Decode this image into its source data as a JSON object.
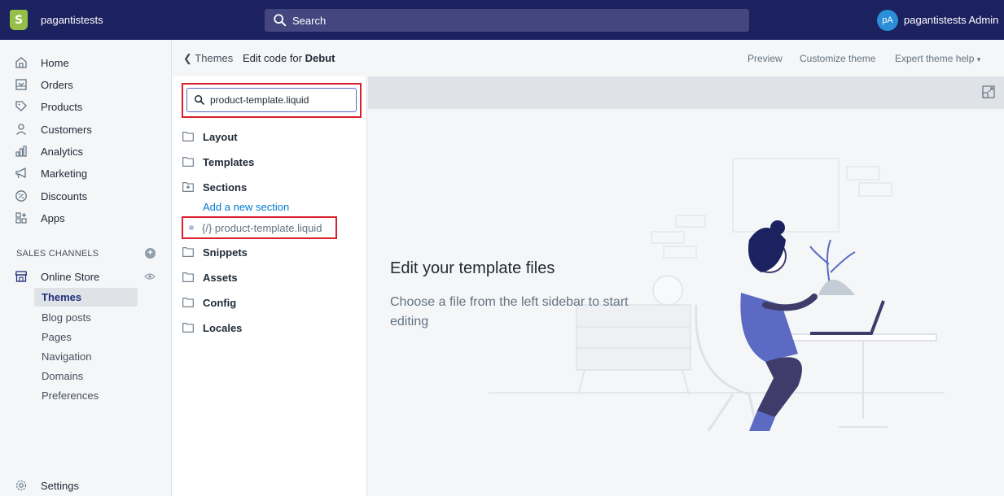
{
  "topbar": {
    "logo_letter": "S",
    "store_name": "pagantistests",
    "search_placeholder": "Search",
    "avatar_initials": "pA",
    "admin_name": "pagantistests Admin"
  },
  "sidebar": {
    "items": [
      {
        "label": "Home",
        "icon": "home-icon"
      },
      {
        "label": "Orders",
        "icon": "orders-icon"
      },
      {
        "label": "Products",
        "icon": "tag-icon"
      },
      {
        "label": "Customers",
        "icon": "person-icon"
      },
      {
        "label": "Analytics",
        "icon": "bar-chart-icon"
      },
      {
        "label": "Marketing",
        "icon": "megaphone-icon"
      },
      {
        "label": "Discounts",
        "icon": "discount-icon"
      },
      {
        "label": "Apps",
        "icon": "apps-icon"
      }
    ],
    "sales_channels_label": "SALES CHANNELS",
    "online_store_label": "Online Store",
    "sub_items": [
      "Themes",
      "Blog posts",
      "Pages",
      "Navigation",
      "Domains",
      "Preferences"
    ],
    "settings_label": "Settings"
  },
  "header": {
    "back_label": "Themes",
    "edit_prefix": "Edit code for",
    "theme_name": "Debut",
    "preview_label": "Preview",
    "customize_label": "Customize theme",
    "expert_help_label": "Expert theme help"
  },
  "file_panel": {
    "search_value": "product-template.liquid",
    "folders_top": [
      "Layout",
      "Templates",
      "Sections"
    ],
    "add_section_label": "Add a new section",
    "file_name": "{/} product-template.liquid",
    "folders_bottom": [
      "Snippets",
      "Assets",
      "Config",
      "Locales"
    ]
  },
  "editor": {
    "empty_title": "Edit your template files",
    "empty_desc": "Choose a file from the left sidebar to start editing"
  },
  "colors": {
    "topbar_bg": "#1c2260",
    "highlight_red": "#d8212b",
    "link_blue": "#007ace",
    "illustration_purple": "#5c6ac4"
  }
}
